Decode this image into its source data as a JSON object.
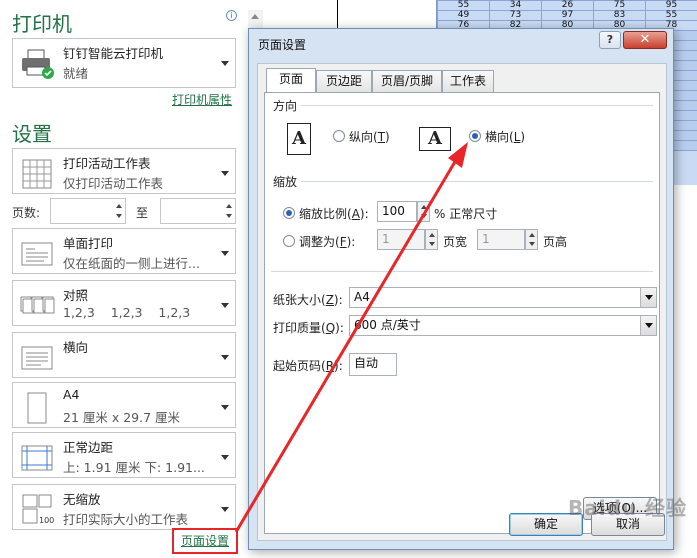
{
  "left": {
    "printer_title": "打印机",
    "printer": {
      "name": "钉钉智能云打印机",
      "status": "就绪"
    },
    "printer_props_link": "打印机属性",
    "settings_title": "设置",
    "options": [
      {
        "l1": "打印活动工作表",
        "l2": "仅打印活动工作表",
        "icon": "sheet-grid-icon"
      },
      {
        "l1": "单面打印",
        "l2": "仅在纸面的一侧上进行...",
        "icon": "single-side-icon"
      },
      {
        "l1": "对照",
        "l2": "1,2,3    1,2,3    1,2,3",
        "icon": "collate-icon"
      },
      {
        "l1": "横向",
        "l2": "",
        "icon": "landscape-icon"
      },
      {
        "l1": "A4",
        "l2": "21 厘米 x 29.7 厘米",
        "icon": "paper-icon"
      },
      {
        "l1": "正常边距",
        "l2": "上: 1.91 厘米 下: 1.91...",
        "icon": "margins-icon"
      },
      {
        "l1": "无缩放",
        "l2": "打印实际大小的工作表",
        "icon": "scale-icon"
      }
    ],
    "pages_label": "页数:",
    "to_label": "至",
    "page_setup_link": "页面设置"
  },
  "sheet": {
    "rows": [
      [
        "55",
        "34",
        "26",
        "75",
        "95"
      ],
      [
        "49",
        "73",
        "97",
        "83",
        "55"
      ],
      [
        "76",
        "82",
        "80",
        "80",
        "78"
      ]
    ]
  },
  "dialog": {
    "title": "页面设置",
    "help": "?",
    "close": "✕",
    "tabs": [
      "页面",
      "页边距",
      "页眉/页脚",
      "工作表"
    ],
    "orientation_label": "方向",
    "portrait": {
      "text": "纵向(",
      "key": "T",
      "end": ")"
    },
    "landscape": {
      "text": "横向(",
      "key": "L",
      "end": ")"
    },
    "orientation_icon_letter": "A",
    "scaling_label": "缩放",
    "scale_pct": {
      "text": "缩放比例(",
      "key": "A",
      "end": "):"
    },
    "scale_value": "100",
    "scale_suffix": "% 正常尺寸",
    "fit_to": {
      "text": "调整为(",
      "key": "F",
      "end": "):"
    },
    "fit_wide_value": "1",
    "fit_wide_label": "页宽",
    "fit_tall_value": "1",
    "fit_tall_label": "页高",
    "paper_size": {
      "text": "纸张大小(",
      "key": "Z",
      "end": "):"
    },
    "paper_size_value": "A4",
    "print_quality": {
      "text": "打印质量(",
      "key": "Q",
      "end": "):"
    },
    "print_quality_value": "600 点/英寸",
    "first_page": {
      "text": "起始页码(",
      "key": "R",
      "end": "):"
    },
    "first_page_value": "自动",
    "options_btn": "选项(O)...",
    "ok_btn": "确定",
    "cancel_btn": "取消"
  },
  "watermark": "Baidu 经验",
  "accent_colors": {
    "excel_green": "#217346",
    "annotation_red": "#e8262a"
  }
}
